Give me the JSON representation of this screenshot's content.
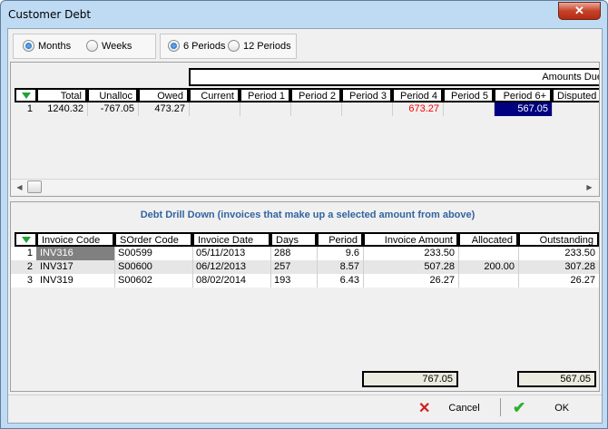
{
  "window": {
    "title": "Customer Debt",
    "close_label": "✕"
  },
  "options": {
    "period_unit": [
      {
        "label": "Months",
        "selected": true
      },
      {
        "label": "Weeks",
        "selected": false
      }
    ],
    "period_count": [
      {
        "label": "6 Periods",
        "selected": true
      },
      {
        "label": "12 Periods",
        "selected": false
      }
    ]
  },
  "summary": {
    "group_header": "Amounts Due",
    "columns": [
      "Total",
      "Unalloc",
      "Owed",
      "Current",
      "Period 1",
      "Period 2",
      "Period 3",
      "Period 4",
      "Period 5",
      "Period 6+",
      "Disputed"
    ],
    "rows": [
      {
        "num": "1",
        "total": "1240.32",
        "unalloc": "-767.05",
        "owed": "473.27",
        "current": "",
        "p1": "",
        "p2": "",
        "p3": "",
        "p4": "673.27",
        "p5": "",
        "p6": "567.05",
        "disputed": ""
      }
    ],
    "colors": {
      "p4_text": "#ff0000",
      "p6_selected_bg": "#000080"
    }
  },
  "drill": {
    "title": "Debt Drill Down (invoices that make up a selected amount from above)",
    "columns": [
      "Invoice Code",
      "SOrder Code",
      "Invoice Date",
      "Days",
      "Period",
      "Invoice Amount",
      "Allocated",
      "Outstanding"
    ],
    "rows": [
      {
        "num": "1",
        "invoice": "INV316",
        "sorder": "S00599",
        "date": "05/11/2013",
        "days": "288",
        "period": "9.6",
        "amount": "233.50",
        "allocated": "",
        "outstanding": "233.50"
      },
      {
        "num": "2",
        "invoice": "INV317",
        "sorder": "S00600",
        "date": "06/12/2013",
        "days": "257",
        "period": "8.57",
        "amount": "507.28",
        "allocated": "200.00",
        "outstanding": "307.28"
      },
      {
        "num": "3",
        "invoice": "INV319",
        "sorder": "S00602",
        "date": "08/02/2014",
        "days": "193",
        "period": "6.43",
        "amount": "26.27",
        "allocated": "",
        "outstanding": "26.27"
      }
    ],
    "totals": {
      "amount": "767.05",
      "outstanding": "567.05"
    }
  },
  "footer": {
    "cancel_label": "Cancel",
    "ok_label": "OK"
  }
}
